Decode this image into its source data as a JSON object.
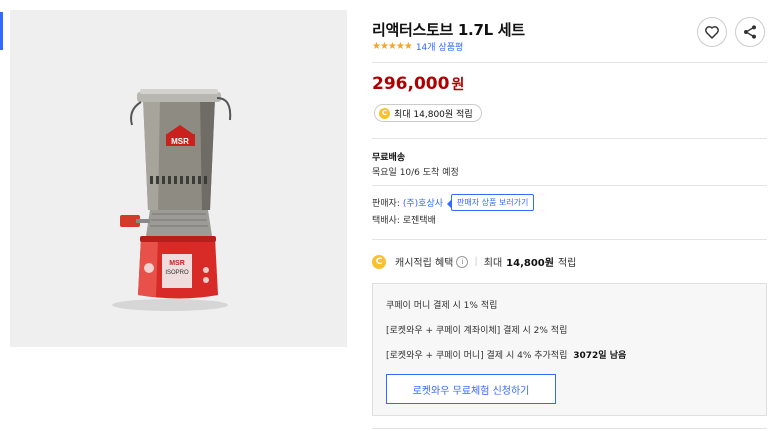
{
  "product": {
    "title": "리액터스토브 1.7L 세트",
    "rating_stars": "★★★★★",
    "review_count": "14개 상품평",
    "price": "296,000",
    "currency": "원",
    "reward_coin": "C",
    "reward_max": "최대 14,800원 적립",
    "image_brand_label": "MSR"
  },
  "shipping": {
    "title": "무료배송",
    "eta": "목요일 10/6 도착 예정"
  },
  "seller": {
    "label": "판매자:",
    "name": "(주)호상사",
    "view_more": "판매자 상품 보러가기",
    "delivery": "택배사: 로젠택배"
  },
  "cash": {
    "label": "캐시적립 혜택",
    "max": "최대",
    "amount": "14,800원",
    "suffix": "적립"
  },
  "benefits": {
    "line1": "쿠페이 머니 결제 시 1% 적립",
    "line2": "[로켓와우 + 쿠페이 계좌이체] 결제 시 2% 적립",
    "line3_prefix": "[로켓와우 + 쿠페이 머니] 결제 시 4% 추가적립",
    "line3_bold": "3072일 남음",
    "trial_button": "로켓와우 무료체험 신청하기"
  },
  "colors": {
    "price": "#ae0000",
    "link": "#346aff",
    "star": "#f5a623",
    "coin": "#f9c12c"
  },
  "icons": [
    "heart-icon",
    "share-icon",
    "info-icon",
    "coin-icon",
    "star-icon"
  ]
}
